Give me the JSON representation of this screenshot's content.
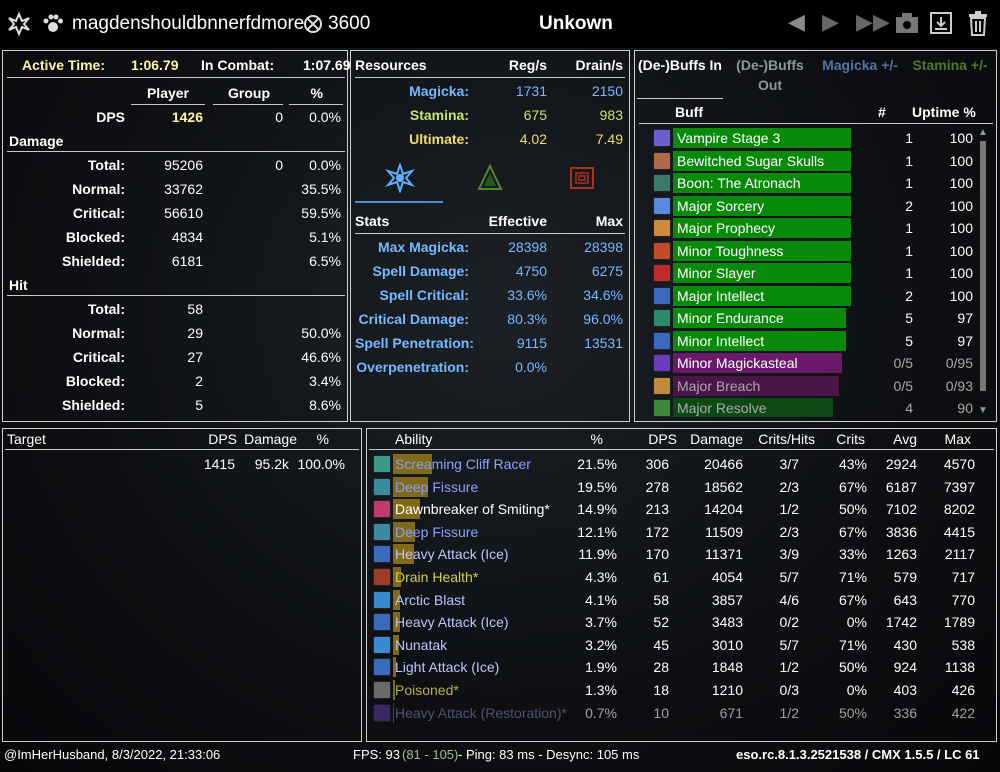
{
  "header": {
    "player_name": "magdenshouldbnnerfdmore",
    "score": "3600",
    "title": "Unkown"
  },
  "summary": {
    "active_time_label": "Active Time:",
    "active_time": "1:06.79",
    "in_combat_label": "In Combat:",
    "in_combat": "1:07.69",
    "cols": [
      "Player",
      "Group",
      "%"
    ],
    "dps_label": "DPS",
    "dps": [
      "1426",
      "0",
      "0.0%"
    ],
    "damage_label": "Damage",
    "damage_rows": [
      [
        "Total:",
        "95206",
        "0",
        "0.0%"
      ],
      [
        "Normal:",
        "33762",
        "",
        "35.5%"
      ],
      [
        "Critical:",
        "56610",
        "",
        "59.5%"
      ],
      [
        "Blocked:",
        "4834",
        "",
        "5.1%"
      ],
      [
        "Shielded:",
        "6181",
        "",
        "6.5%"
      ]
    ],
    "hit_label": "Hit",
    "hit_rows": [
      [
        "Total:",
        "58",
        "",
        ""
      ],
      [
        "Normal:",
        "29",
        "",
        "50.0%"
      ],
      [
        "Critical:",
        "27",
        "",
        "46.6%"
      ],
      [
        "Blocked:",
        "2",
        "",
        "3.4%"
      ],
      [
        "Shielded:",
        "5",
        "",
        "8.6%"
      ]
    ]
  },
  "resources": {
    "title": "Resources",
    "cols": [
      "Reg/s",
      "Drain/s"
    ],
    "rows": [
      [
        "Magicka:",
        "1731",
        "2150"
      ],
      [
        "Stamina:",
        "675",
        "983"
      ],
      [
        "Ultimate:",
        "4.02",
        "7.49"
      ]
    ],
    "stats_title": "Stats",
    "stats_cols": [
      "Effective",
      "Max"
    ],
    "stats": [
      [
        "Max Magicka:",
        "28398",
        "28398"
      ],
      [
        "Spell Damage:",
        "4750",
        "6275"
      ],
      [
        "Spell Critical:",
        "33.6%",
        "34.6%"
      ],
      [
        "Critical Damage:",
        "80.3%",
        "96.0%"
      ],
      [
        "Spell Penetration:",
        "9115",
        "13531"
      ],
      [
        "Overpenetration:",
        "0.0%",
        ""
      ]
    ]
  },
  "buffs": {
    "tabs": [
      "(De-)Buffs In",
      "(De-)Buffs Out",
      "Magicka +/-",
      "Stamina +/-"
    ],
    "cols": [
      "Buff",
      "#",
      "Uptime %"
    ],
    "rows": [
      {
        "name": "Vampire Stage 3",
        "count": "1",
        "uptime": "100",
        "color": "#0a8a0a",
        "icon": "vampire-icon",
        "u": 1.0
      },
      {
        "name": "Bewitched Sugar Skulls",
        "count": "1",
        "uptime": "100",
        "color": "#0a8a0a",
        "icon": "skull-icon",
        "u": 1.0
      },
      {
        "name": "Boon: The Atronach",
        "count": "1",
        "uptime": "100",
        "color": "#0a8a0a",
        "icon": "atronach-icon",
        "u": 1.0
      },
      {
        "name": "Major Sorcery",
        "count": "2",
        "uptime": "100",
        "color": "#0a8a0a",
        "icon": "sorcery-icon",
        "u": 1.0
      },
      {
        "name": "Major Prophecy",
        "count": "1",
        "uptime": "100",
        "color": "#0a8a0a",
        "icon": "prophecy-icon",
        "u": 1.0
      },
      {
        "name": "Minor Toughness",
        "count": "1",
        "uptime": "100",
        "color": "#0a8a0a",
        "icon": "toughness-icon",
        "u": 1.0
      },
      {
        "name": "Minor Slayer",
        "count": "1",
        "uptime": "100",
        "color": "#0a8a0a",
        "icon": "slayer-icon",
        "u": 1.0
      },
      {
        "name": "Major Intellect",
        "count": "2",
        "uptime": "100",
        "color": "#0a8a0a",
        "icon": "intellect-icon",
        "u": 1.0
      },
      {
        "name": "Minor Endurance",
        "count": "5",
        "uptime": "97",
        "color": "#0a8a0a",
        "icon": "endurance-icon",
        "u": 0.97
      },
      {
        "name": "Minor Intellect",
        "count": "5",
        "uptime": "97",
        "color": "#0a8a0a",
        "icon": "intellect-icon",
        "u": 0.97
      },
      {
        "name": "Minor Magickasteal",
        "count": "0/5",
        "uptime": "0/95",
        "color": "#6a1a6a",
        "icon": "magickasteal-icon",
        "u": 0.95
      },
      {
        "name": "Major Breach",
        "count": "0/5",
        "uptime": "0/93",
        "color": "#4a1547",
        "icon": "breach-icon",
        "u": 0.93
      },
      {
        "name": "Major Resolve",
        "count": "4",
        "uptime": "90",
        "color": "#0c4a14",
        "icon": "resolve-icon",
        "u": 0.9
      }
    ]
  },
  "target": {
    "cols": [
      "Target",
      "DPS",
      "Damage",
      "%"
    ],
    "row": [
      "",
      "1415",
      "95.2k",
      "100.0%"
    ]
  },
  "abilities": {
    "cols": [
      "Ability",
      "%",
      "DPS",
      "Damage",
      "Crits/Hits",
      "Crits",
      "Avg",
      "Max"
    ],
    "rows": [
      {
        "name": "Screaming Cliff Racer",
        "pct": "21.5%",
        "dps": "306",
        "damage": "20466",
        "ch": "3/7",
        "crits": "43%",
        "avg": "2924",
        "max": "4570",
        "color": "#8aa0ff",
        "icon": "cliff-racer-icon",
        "p": 21.5
      },
      {
        "name": "Deep Fissure",
        "pct": "19.5%",
        "dps": "278",
        "damage": "18562",
        "ch": "2/3",
        "crits": "67%",
        "avg": "6187",
        "max": "7397",
        "color": "#8aa0ff",
        "icon": "fissure-icon",
        "p": 19.5
      },
      {
        "name": "Dawnbreaker of Smiting*",
        "pct": "14.9%",
        "dps": "213",
        "damage": "14204",
        "ch": "1/2",
        "crits": "50%",
        "avg": "7102",
        "max": "8202",
        "color": "#ffffff",
        "icon": "dawnbreaker-icon",
        "p": 14.9
      },
      {
        "name": "Deep Fissure",
        "pct": "12.1%",
        "dps": "172",
        "damage": "11509",
        "ch": "2/3",
        "crits": "67%",
        "avg": "3836",
        "max": "4415",
        "color": "#8aa0ff",
        "icon": "fissure-icon",
        "p": 12.1
      },
      {
        "name": "Heavy Attack (Ice)",
        "pct": "11.9%",
        "dps": "170",
        "damage": "11371",
        "ch": "3/9",
        "crits": "33%",
        "avg": "1263",
        "max": "2117",
        "color": "#b9c8ff",
        "icon": "ice-staff-icon",
        "p": 11.9
      },
      {
        "name": "Drain Health*",
        "pct": "4.3%",
        "dps": "61",
        "damage": "4054",
        "ch": "5/7",
        "crits": "71%",
        "avg": "579",
        "max": "717",
        "color": "#d4d04a",
        "icon": "drain-health-icon",
        "p": 4.3
      },
      {
        "name": "Arctic Blast",
        "pct": "4.1%",
        "dps": "58",
        "damage": "3857",
        "ch": "4/6",
        "crits": "67%",
        "avg": "643",
        "max": "770",
        "color": "#b9c8ff",
        "icon": "arctic-blast-icon",
        "p": 4.1
      },
      {
        "name": "Heavy Attack (Ice)",
        "pct": "3.7%",
        "dps": "52",
        "damage": "3483",
        "ch": "0/2",
        "crits": "0%",
        "avg": "1742",
        "max": "1789",
        "color": "#b9c8ff",
        "icon": "ice-staff-icon",
        "p": 3.7
      },
      {
        "name": "Nunatak",
        "pct": "3.2%",
        "dps": "45",
        "damage": "3010",
        "ch": "5/7",
        "crits": "71%",
        "avg": "430",
        "max": "538",
        "color": "#b9c8ff",
        "icon": "nunatak-icon",
        "p": 3.2
      },
      {
        "name": "Light Attack (Ice)",
        "pct": "1.9%",
        "dps": "28",
        "damage": "1848",
        "ch": "1/2",
        "crits": "50%",
        "avg": "924",
        "max": "1138",
        "color": "#b9c8ff",
        "icon": "ice-staff-icon",
        "p": 1.9
      },
      {
        "name": "Poisoned*",
        "pct": "1.3%",
        "dps": "18",
        "damage": "1210",
        "ch": "0/3",
        "crits": "0%",
        "avg": "403",
        "max": "426",
        "color": "#b8b045",
        "icon": "poison-icon",
        "p": 1.3
      },
      {
        "name": "Heavy Attack (Restoration)*",
        "pct": "0.7%",
        "dps": "10",
        "damage": "671",
        "ch": "1/2",
        "crits": "50%",
        "avg": "336",
        "max": "422",
        "color": "#7f7ab8",
        "icon": "resto-staff-icon",
        "p": 0.7
      }
    ]
  },
  "footer": {
    "account": "@ImHerHusband, 8/3/2022, 21:33:06",
    "fps_label": "FPS: 93",
    "fps_range": "(81 - 105)",
    "ping": "- Ping: 83 ms - Desync: 105 ms",
    "version": "eso.rc.8.1.3.2521538 / CMX 1.5.5 / LC 61"
  }
}
